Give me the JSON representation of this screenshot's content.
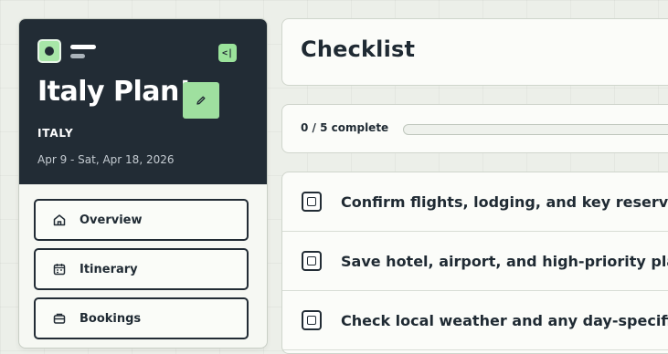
{
  "sidebar": {
    "trip_title": "Italy Plan!",
    "country": "ITALY",
    "dates": "Apr 9 - Sat, Apr 18, 2026",
    "collapse_glyph": "<|",
    "nav": [
      {
        "label": "Overview",
        "icon": "home-icon"
      },
      {
        "label": "Itinerary",
        "icon": "calendar-icon"
      },
      {
        "label": "Bookings",
        "icon": "ticket-icon"
      }
    ]
  },
  "main": {
    "title": "Checklist",
    "progress": {
      "text": "0 / 5 complete",
      "completed": 0,
      "total": 5
    },
    "tasks": [
      {
        "text": "Confirm flights, lodging, and key reservati",
        "done": false
      },
      {
        "text": "Save hotel, airport, and high-priority place",
        "done": false
      },
      {
        "text": "Check local weather and any day-specific",
        "done": false
      }
    ]
  },
  "colors": {
    "sidebar_header": "#222c35",
    "accent_green": "#9fe09f",
    "background": "#ecefe9"
  }
}
